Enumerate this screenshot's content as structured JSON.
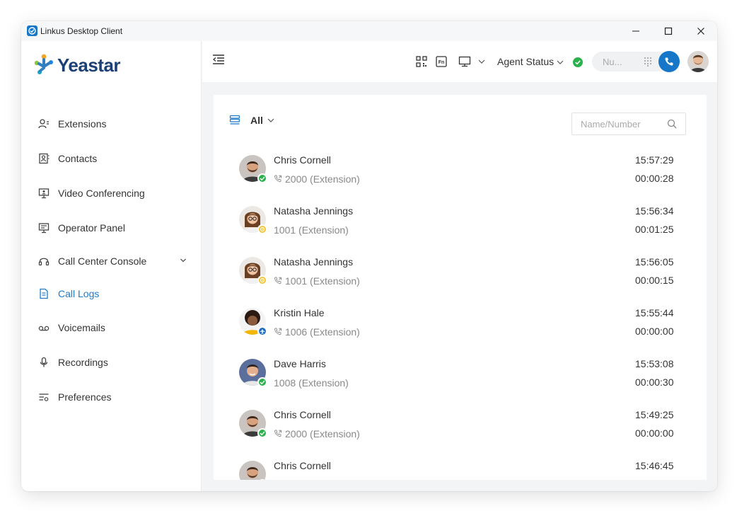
{
  "window": {
    "title": "Linkus Desktop Client"
  },
  "brand": {
    "name": "Yeastar"
  },
  "colors": {
    "accent": "#1677c8",
    "active_nav": "#1e7bc9",
    "online": "#2bb24c",
    "away": "#f2c230",
    "busy": "#1e6fc0"
  },
  "sidebar": {
    "items": [
      {
        "label": "Extensions",
        "icon": "extensions-icon"
      },
      {
        "label": "Contacts",
        "icon": "contacts-icon"
      },
      {
        "label": "Video Conferencing",
        "icon": "video-conferencing-icon"
      },
      {
        "label": "Operator Panel",
        "icon": "operator-panel-icon"
      },
      {
        "label": "Call Center Console",
        "icon": "headset-icon"
      },
      {
        "label": "Call Logs",
        "icon": "call-logs-icon",
        "active": true
      },
      {
        "label": "Voicemails",
        "icon": "voicemail-icon"
      },
      {
        "label": "Recordings",
        "icon": "microphone-icon"
      },
      {
        "label": "Preferences",
        "icon": "preferences-icon"
      }
    ]
  },
  "topbar": {
    "agent_status": "Agent Status",
    "search_placeholder": "Nu..."
  },
  "panel": {
    "filter": "All",
    "search_placeholder": "Name/Number"
  },
  "call_logs": [
    {
      "name": "Chris Cornell",
      "number": "2000 (Extension)",
      "time": "15:57:29",
      "duration": "00:00:28",
      "status": "online",
      "call_icon": true,
      "avatar": "man-beard"
    },
    {
      "name": "Natasha Jennings",
      "number": "1001 (Extension)",
      "time": "15:56:34",
      "duration": "00:01:25",
      "status": "away",
      "call_icon": false,
      "avatar": "woman-glasses"
    },
    {
      "name": "Natasha Jennings",
      "number": "1001 (Extension)",
      "time": "15:56:05",
      "duration": "00:00:15",
      "status": "away",
      "call_icon": true,
      "avatar": "woman-glasses"
    },
    {
      "name": "Kristin Hale",
      "number": "1006 (Extension)",
      "time": "15:55:44",
      "duration": "00:00:00",
      "status": "busy",
      "call_icon": true,
      "avatar": "woman-curly"
    },
    {
      "name": "Dave Harris",
      "number": "1008 (Extension)",
      "time": "15:53:08",
      "duration": "00:00:30",
      "status": "online",
      "call_icon": false,
      "avatar": "man-smile"
    },
    {
      "name": "Chris Cornell",
      "number": "2000 (Extension)",
      "time": "15:49:25",
      "duration": "00:00:00",
      "status": "online",
      "call_icon": true,
      "avatar": "man-beard"
    },
    {
      "name": "Chris Cornell",
      "number": "",
      "time": "15:46:45",
      "duration": "",
      "status": "online",
      "call_icon": false,
      "avatar": "man-beard"
    }
  ]
}
